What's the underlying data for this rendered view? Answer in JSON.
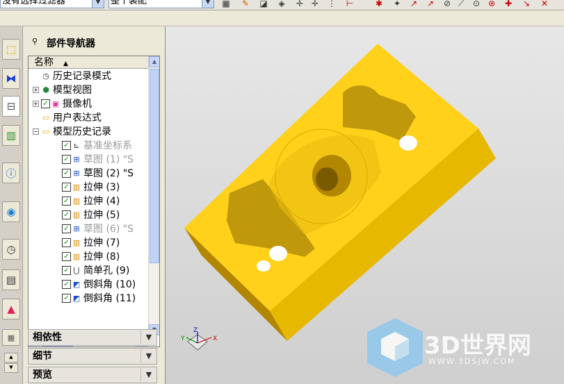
{
  "topbar": {
    "filter_combo": "没有选择过滤器",
    "assembly_combo": "整个装配"
  },
  "icons": [
    "sketch-icon",
    "box-icon",
    "snap-icon",
    "arrow-icon",
    "dimension-icon",
    "view-icon",
    "line-icon",
    "rotate-icon",
    "zoom-icon",
    "measure-icon",
    "close-icon"
  ],
  "rail": {
    "buttons": [
      "assembly-navigator-icon",
      "constraint-navigator-icon",
      "part-navigator-icon",
      "reuse-library-icon",
      "info-icon",
      "web-browser-icon",
      "history-icon",
      "system-materials-icon",
      "palette-icon",
      "process-icon"
    ]
  },
  "navigator": {
    "title": "部件导航器",
    "column_name": "名称",
    "rows": [
      {
        "label": "历史记录模式",
        "icon": "clock-icon",
        "indent": 1,
        "checked": false,
        "gray": false
      },
      {
        "label": "模型视图",
        "icon": "model-view-icon",
        "indent": 1,
        "expand": true,
        "checked": false,
        "gray": false
      },
      {
        "label": "摄像机",
        "icon": "camera-icon",
        "indent": 1,
        "expand": true,
        "checked": true,
        "gray": false
      },
      {
        "label": "用户表达式",
        "icon": "folder-icon",
        "indent": 1,
        "checked": false,
        "gray": false
      },
      {
        "label": "模型历史记录",
        "icon": "folder-icon",
        "indent": 1,
        "expand": true,
        "expanded": true,
        "checked": false,
        "gray": false
      },
      {
        "label": "基准坐标系",
        "icon": "datum-csys-icon",
        "indent": 2,
        "checked": true,
        "gray": true
      },
      {
        "label": "草图 (1) \"S",
        "icon": "sketch-icon",
        "indent": 2,
        "checked": true,
        "gray": true
      },
      {
        "label": "草图 (2) \"S",
        "icon": "sketch-icon",
        "indent": 2,
        "checked": true,
        "gray": false
      },
      {
        "label": "拉伸 (3)",
        "icon": "extrude-icon",
        "indent": 2,
        "checked": true,
        "gray": false
      },
      {
        "label": "拉伸 (4)",
        "icon": "extrude-icon",
        "indent": 2,
        "checked": true,
        "gray": false
      },
      {
        "label": "拉伸 (5)",
        "icon": "extrude-icon",
        "indent": 2,
        "checked": true,
        "gray": false
      },
      {
        "label": "草图 (6) \"S",
        "icon": "sketch-icon",
        "indent": 2,
        "checked": true,
        "gray": true
      },
      {
        "label": "拉伸 (7)",
        "icon": "extrude-icon",
        "indent": 2,
        "checked": true,
        "gray": false
      },
      {
        "label": "拉伸 (8)",
        "icon": "extrude-icon",
        "indent": 2,
        "checked": true,
        "gray": false
      },
      {
        "label": "简单孔 (9)",
        "icon": "hole-icon",
        "indent": 2,
        "checked": true,
        "gray": false
      },
      {
        "label": "倒斜角 (10)",
        "icon": "chamfer-icon",
        "indent": 2,
        "checked": true,
        "gray": false
      },
      {
        "label": "倒斜角 (11)",
        "icon": "chamfer-icon",
        "indent": 2,
        "checked": true,
        "gray": false
      }
    ],
    "sections": [
      "相依性",
      "细节",
      "预览"
    ]
  },
  "viewport": {
    "part_color": "#ffd11a",
    "part_side_color": "#e6b800",
    "part_dark_color": "#b38600",
    "triad": {
      "x": "X",
      "y": "Y",
      "z": "Z"
    }
  },
  "watermark": {
    "brand": "3D世界网",
    "url": "WWW.3DSJW.COM"
  }
}
